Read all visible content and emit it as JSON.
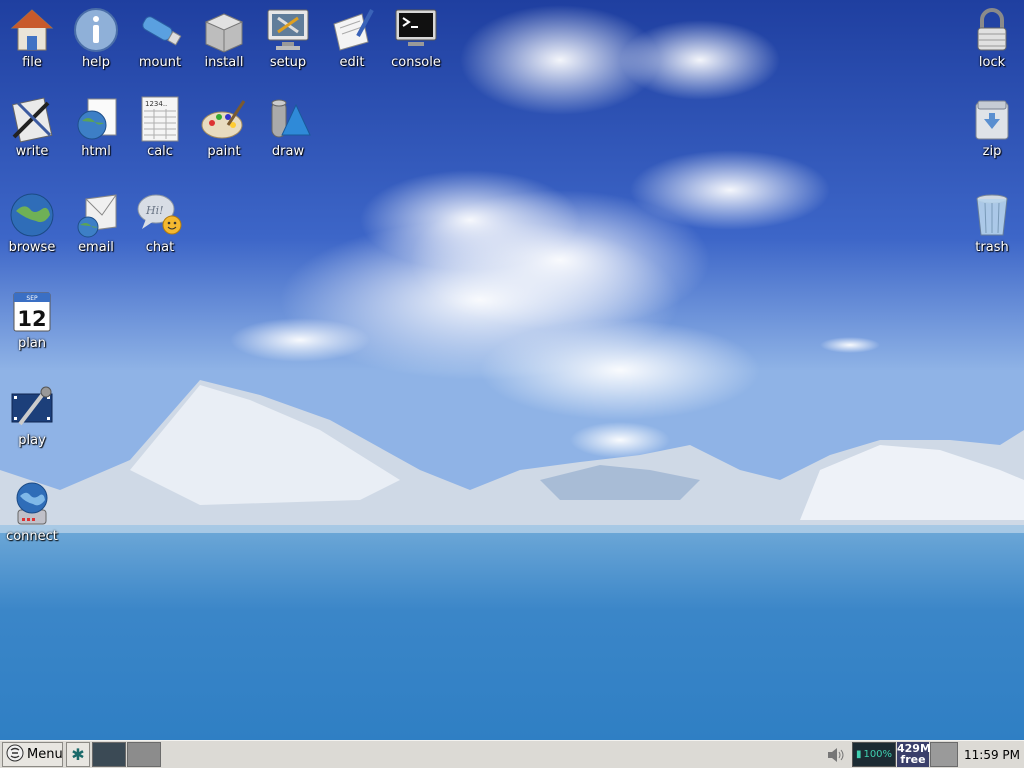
{
  "desktop": {
    "icons": [
      {
        "label": "file",
        "icon": "home-folder-icon"
      },
      {
        "label": "help",
        "icon": "info-icon"
      },
      {
        "label": "mount",
        "icon": "usb-drive-icon"
      },
      {
        "label": "install",
        "icon": "package-box-icon"
      },
      {
        "label": "setup",
        "icon": "setup-tools-icon"
      },
      {
        "label": "edit",
        "icon": "text-edit-icon"
      },
      {
        "label": "console",
        "icon": "terminal-icon"
      },
      {
        "label": "write",
        "icon": "word-processor-icon"
      },
      {
        "label": "html",
        "icon": "web-editor-icon"
      },
      {
        "label": "calc",
        "icon": "spreadsheet-icon"
      },
      {
        "label": "paint",
        "icon": "palette-icon"
      },
      {
        "label": "draw",
        "icon": "draw-shapes-icon"
      },
      {
        "label": "browse",
        "icon": "globe-icon"
      },
      {
        "label": "email",
        "icon": "envelope-icon"
      },
      {
        "label": "chat",
        "icon": "chat-bubble-icon"
      },
      {
        "label": "plan",
        "icon": "calendar-icon",
        "day": "12",
        "month": "SEP"
      },
      {
        "label": "play",
        "icon": "media-player-icon"
      },
      {
        "label": "connect",
        "icon": "network-globe-icon"
      },
      {
        "label": "lock",
        "icon": "padlock-icon"
      },
      {
        "label": "zip",
        "icon": "archive-icon"
      },
      {
        "label": "trash",
        "icon": "trash-bin-icon"
      }
    ]
  },
  "taskbar": {
    "menu_label": "Menu",
    "battery": "100%",
    "memory_amount": "429M",
    "memory_label": "free",
    "clock": "11:59 PM"
  },
  "colors": {
    "taskbar_bg": "#dcdad5",
    "sky": "#2a4fb5",
    "water": "#3b8fd0"
  }
}
